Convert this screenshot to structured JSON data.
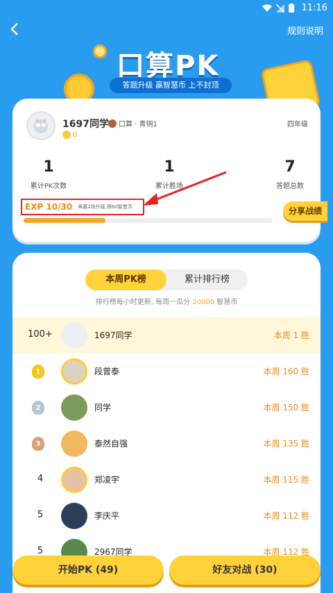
{
  "status": {
    "time": "11:16"
  },
  "header": {
    "rules_label": "规则说明"
  },
  "hero": {
    "title": "口算PK",
    "subtitle": "答题升级 赢智慧币 上不封顶"
  },
  "profile": {
    "name": "1697同学",
    "rank": "口算 · 青铜1",
    "coins": "0",
    "grade": "四年级",
    "stats": [
      {
        "value": "1",
        "label": "累计PK次数"
      },
      {
        "value": "1",
        "label": "累计胜场"
      },
      {
        "value": "7",
        "label": "答题总数"
      }
    ],
    "exp_label": "EXP 10/30",
    "exp_tip": "再赢2场升级,得60智慧币",
    "exp_progress": 0.33,
    "share_label": "分享战绩"
  },
  "leaderboard": {
    "tabs": [
      {
        "label": "本周PK榜",
        "active": true
      },
      {
        "label": "累计排行榜",
        "active": false
      }
    ],
    "notice_prefix": "排行榜每小时更新, 每周一瓜分 ",
    "notice_amount": "20000",
    "notice_suffix": " 智慧币",
    "me": {
      "rank": "100+",
      "name": "1697同学",
      "wins": "本周 1 胜"
    },
    "rows": [
      {
        "rank": "1",
        "name": "段曾泰",
        "wins": "本周 160 胜",
        "vip": true,
        "avatar_color": "#d9d3c0",
        "badge_color": "#f5c518"
      },
      {
        "rank": "2",
        "name": "同学",
        "wins": "本周 150 胜",
        "vip": false,
        "avatar_color": "#7a9c5a",
        "badge_color": "#b8c4d0"
      },
      {
        "rank": "3",
        "name": "泰然自强",
        "wins": "本周 135 胜",
        "vip": false,
        "avatar_color": "#f0b860",
        "badge_color": "#d8a074"
      },
      {
        "rank": "4",
        "name": "郑凌宇",
        "wins": "本周 115 胜",
        "vip": true,
        "avatar_color": "#e8c0a8",
        "badge_color": ""
      },
      {
        "rank": "5",
        "name": "李庆平",
        "wins": "本周 112 胜",
        "vip": false,
        "avatar_color": "#2c3f5a",
        "badge_color": ""
      },
      {
        "rank": "5",
        "name": "2967同学",
        "wins": "本周 112 胜",
        "vip": false,
        "avatar_color": "#5a8a4a",
        "badge_color": ""
      }
    ]
  },
  "footer": {
    "start_label": "开始PK (49)",
    "friend_label": "好友对战 (30)"
  },
  "colors": {
    "bg": "#2a9cf0",
    "accent": "#ffd23a",
    "orange": "#f08a1a"
  }
}
